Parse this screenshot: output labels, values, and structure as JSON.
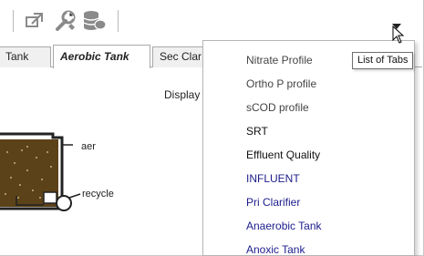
{
  "tabs": [
    {
      "label": "Tank"
    },
    {
      "label": "Aerobic Tank",
      "active": true
    },
    {
      "label": "Sec Clar"
    }
  ],
  "content": {
    "display_label": "Display",
    "aer_label": "aer",
    "recycle_label": "recycle"
  },
  "toolbar": {
    "icons": [
      "export-icon",
      "tools-icon",
      "database-icon",
      "dropdown-arrow-icon"
    ]
  },
  "menu": {
    "items": [
      {
        "label": "Nitrate Profile",
        "tone": "gray"
      },
      {
        "label": "Ortho P profile",
        "tone": "gray"
      },
      {
        "label": "sCOD profile",
        "tone": "gray"
      },
      {
        "label": "SRT",
        "tone": "dark"
      },
      {
        "label": "Effluent Quality",
        "tone": "dark"
      },
      {
        "label": "INFLUENT",
        "tone": "blue"
      },
      {
        "label": "Pri Clarifier",
        "tone": "blue"
      },
      {
        "label": "Anaerobic Tank",
        "tone": "blue"
      },
      {
        "label": "Anoxic Tank",
        "tone": "blue"
      }
    ]
  },
  "tooltip": {
    "text": "List of Tabs"
  },
  "colors": {
    "menu_blue": "#1c1c8c",
    "menu_gray": "#444444",
    "tank_brown": "#7a5a2a"
  }
}
